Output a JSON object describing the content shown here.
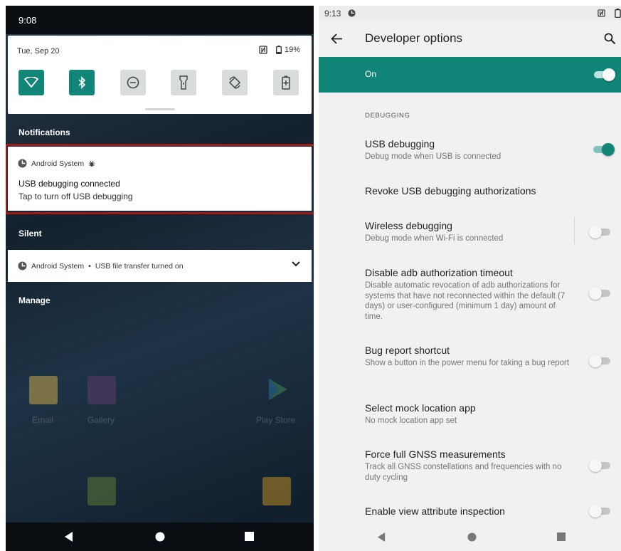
{
  "left": {
    "status": {
      "time": "9:08"
    },
    "quick_settings": {
      "date": "Tue, Sep 20",
      "battery": "19%",
      "tiles": [
        {
          "icon": "wifi-icon",
          "state": "on"
        },
        {
          "icon": "bluetooth-icon",
          "state": "on"
        },
        {
          "icon": "do-not-disturb-icon",
          "state": "off"
        },
        {
          "icon": "flashlight-icon",
          "state": "off"
        },
        {
          "icon": "auto-rotate-icon",
          "state": "off"
        },
        {
          "icon": "battery-saver-icon",
          "state": "off"
        }
      ]
    },
    "sections": {
      "notifications": "Notifications",
      "silent": "Silent",
      "manage": "Manage"
    },
    "usb_notification": {
      "app": "Android System",
      "title": "USB debugging connected",
      "text": "Tap to turn off USB debugging"
    },
    "silent_notification": {
      "app": "Android System",
      "text": "USB file transfer turned on",
      "separator": "•"
    },
    "home_apps": {
      "email": "Email",
      "gallery": "Gallery",
      "play_store": "Play Store"
    },
    "nav": [
      "back-icon",
      "home-icon",
      "recents-icon"
    ]
  },
  "right": {
    "status": {
      "time": "9:13"
    },
    "toolbar": {
      "title": "Developer options"
    },
    "master": {
      "label": "On",
      "checked": true
    },
    "category": "DEBUGGING",
    "prefs": [
      {
        "title": "USB debugging",
        "summary": "Debug mode when USB is connected",
        "switch": "on"
      },
      {
        "title": "Revoke USB debugging authorizations",
        "summary": "",
        "switch": "none"
      },
      {
        "title": "Wireless debugging",
        "summary": "Debug mode when Wi-Fi is connected",
        "switch": "off"
      },
      {
        "title": "Disable adb authorization timeout",
        "summary": "Disable automatic revocation of adb authorizations for systems that have not reconnected within the default (7 days) or user-configured (minimum 1 day) amount of time.",
        "switch": "off"
      },
      {
        "title": "Bug report shortcut",
        "summary": "Show a button in the power menu for taking a bug report",
        "switch": "off"
      },
      {
        "title": "Select mock location app",
        "summary": "No mock location app set",
        "switch": "none"
      },
      {
        "title": "Force full GNSS measurements",
        "summary": "Track all GNSS constellations and frequencies with no duty cycling",
        "switch": "off"
      },
      {
        "title": "Enable view attribute inspection",
        "summary": "",
        "switch": "off"
      }
    ]
  },
  "colors": {
    "accent": "#128579",
    "highlight": "#9b1b1b"
  }
}
